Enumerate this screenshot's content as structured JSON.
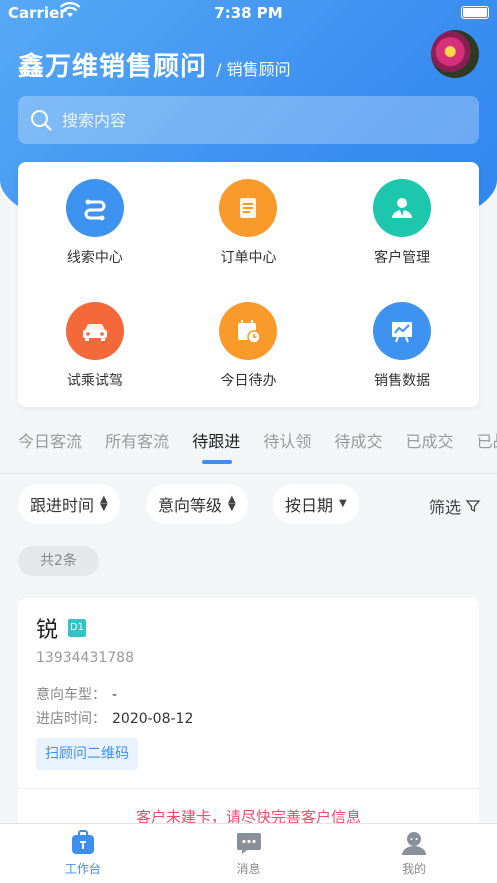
{
  "status": {
    "carrier": "Carrier",
    "time": "7:38 PM"
  },
  "header": {
    "title": "鑫万维销售顾问",
    "role": "/ 销售顾问"
  },
  "search": {
    "placeholder": "搜索内容"
  },
  "grid": [
    {
      "label": "线索中心",
      "color": "#3f93f0",
      "icon": "clue-icon"
    },
    {
      "label": "订单中心",
      "color": "#f99a2b",
      "icon": "order-icon"
    },
    {
      "label": "客户管理",
      "color": "#1cc7ad",
      "icon": "customer-icon"
    },
    {
      "label": "试乘试驾",
      "color": "#f4683a",
      "icon": "car-icon"
    },
    {
      "label": "今日待办",
      "color": "#f99a2b",
      "icon": "calendar-icon"
    },
    {
      "label": "销售数据",
      "color": "#3f93f0",
      "icon": "chart-icon"
    }
  ],
  "tabs": [
    "今日客流",
    "所有客流",
    "待跟进",
    "待认领",
    "待成交",
    "已成交",
    "已战败"
  ],
  "active_tab": 2,
  "filters": {
    "follow_time": "跟进时间",
    "intent_level": "意向等级",
    "by_date": "按日期",
    "screen": "筛选",
    "count": "共2条"
  },
  "customer": {
    "name": "锐",
    "level": "D1",
    "phone": "13934431788",
    "model_label": "意向车型：",
    "model_value": "-",
    "visit_label": "进店时间：",
    "visit_value": "2020-08-12",
    "qr_button": "扫顾问二维码",
    "warning": "客户未建卡，请尽快完善客户信息"
  },
  "nav": [
    {
      "label": "工作台",
      "icon": "workbench-icon"
    },
    {
      "label": "消息",
      "icon": "message-icon"
    },
    {
      "label": "我的",
      "icon": "profile-icon"
    }
  ],
  "colors": {
    "primary": "#3c8ff0",
    "warning": "#f04a6c",
    "badge": "#33c3c6"
  }
}
